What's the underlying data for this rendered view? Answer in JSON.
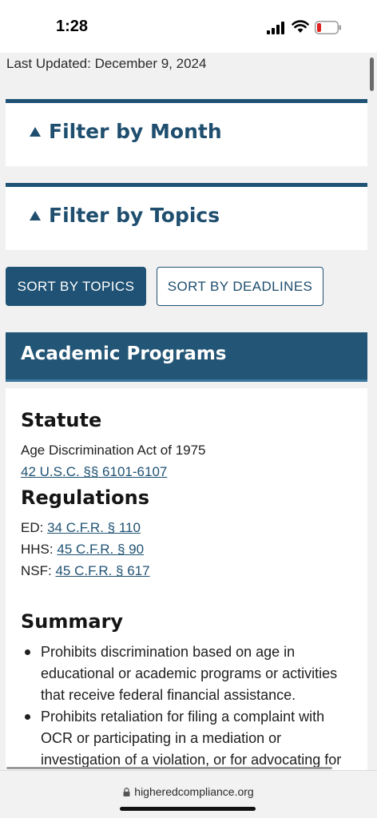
{
  "status_bar": {
    "time": "1:28",
    "icons": [
      "cellular-signal-icon",
      "wifi-icon",
      "battery-low-icon"
    ],
    "battery_color": "#e02020"
  },
  "page": {
    "last_updated": "Last Updated: December 9, 2024",
    "filters": [
      {
        "label": "Filter by Month",
        "icon": "triangle-up-icon"
      },
      {
        "label": "Filter by Topics",
        "icon": "triangle-up-icon"
      }
    ],
    "sort_buttons": {
      "topics": "SORT BY TOPICS",
      "deadlines": "SORT BY DEADLINES"
    },
    "section_title": "Academic Programs",
    "statute": {
      "heading": "Statute",
      "name": "Age Discrimination Act of 1975",
      "citation": "42 U.S.C. §§ 6101-6107"
    },
    "regulations": {
      "heading": "Regulations",
      "items": [
        {
          "agency": "ED:",
          "citation": "34 C.F.R. § 110"
        },
        {
          "agency": "HHS:",
          "citation": "45 C.F.R. § 90"
        },
        {
          "agency": "NSF:",
          "citation": "45 C.F.R. § 617"
        }
      ]
    },
    "summary": {
      "heading": "Summary",
      "bullets": [
        "Prohibits discrimination based on age in educational or academic programs or activities that receive federal financial assistance.",
        "Prohibits retaliation for filing a complaint with OCR or participating in a mediation or investigation of a violation, or for advocating for"
      ]
    }
  },
  "browser": {
    "url": "higheredcompliance.org"
  },
  "colors": {
    "brand": "#1f5274",
    "link": "#1f5274"
  }
}
